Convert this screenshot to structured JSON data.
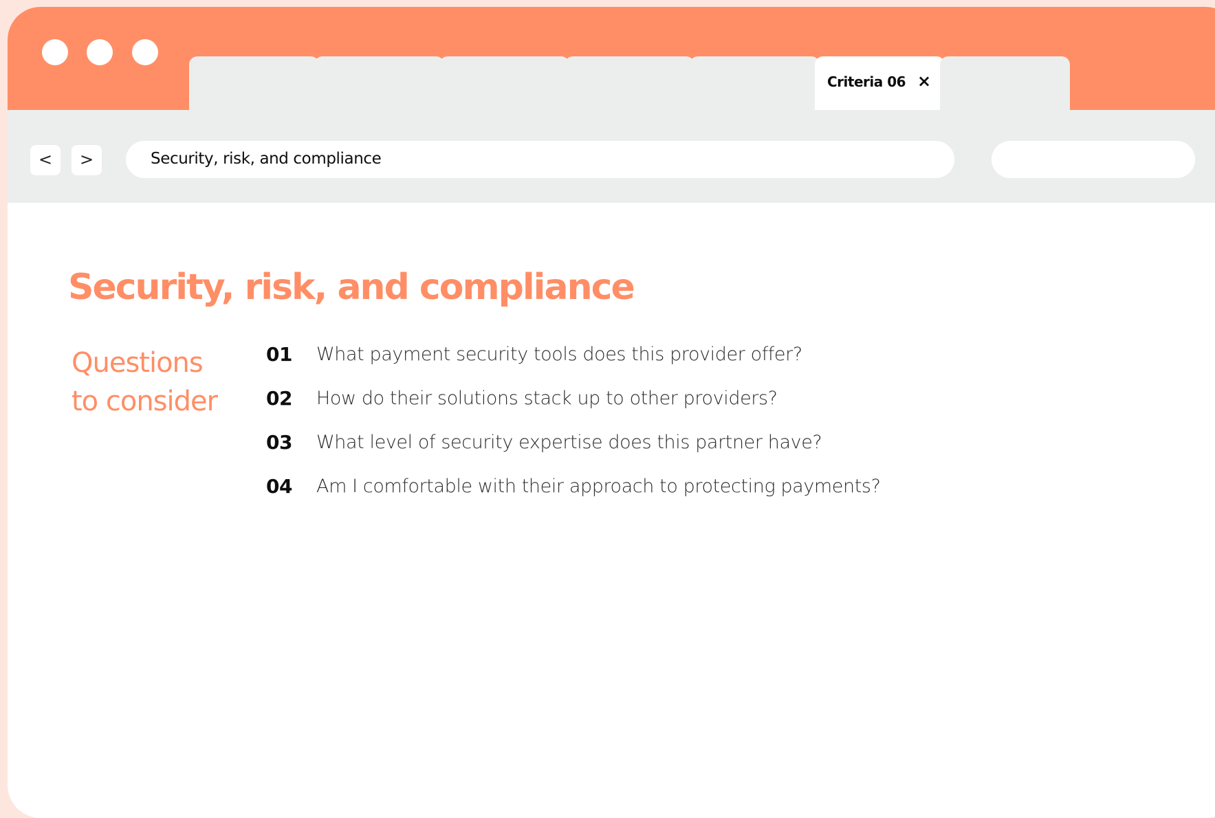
{
  "colors": {
    "accent": "#ff8e66",
    "chrome": "#eceeed",
    "page_background": "#fde6de",
    "text": "#0e0e0e"
  },
  "window_controls": {
    "icons": [
      "window-dot-icon",
      "window-dot-icon",
      "window-dot-icon"
    ]
  },
  "tabs": [
    {
      "label": "",
      "active": false
    },
    {
      "label": "",
      "active": false
    },
    {
      "label": "",
      "active": false
    },
    {
      "label": "",
      "active": false
    },
    {
      "label": "",
      "active": false
    },
    {
      "label": "Criteria 06",
      "active": true,
      "close_icon": "×"
    },
    {
      "label": "",
      "active": false
    }
  ],
  "toolbar": {
    "back_icon": "<",
    "forward_icon": ">",
    "address": "Security, risk, and compliance",
    "search_value": ""
  },
  "main": {
    "heading": "Security, risk, and compliance",
    "questions_label_line1": "Questions",
    "questions_label_line2": "to consider",
    "questions": [
      {
        "number": "01",
        "text": "What payment security tools does this provider offer?"
      },
      {
        "number": "02",
        "text": "How do their solutions stack up to other providers?"
      },
      {
        "number": "03",
        "text": "What level of security expertise does this partner have?"
      },
      {
        "number": "04",
        "text": "Am I comfortable with their approach to protecting payments?"
      }
    ]
  }
}
